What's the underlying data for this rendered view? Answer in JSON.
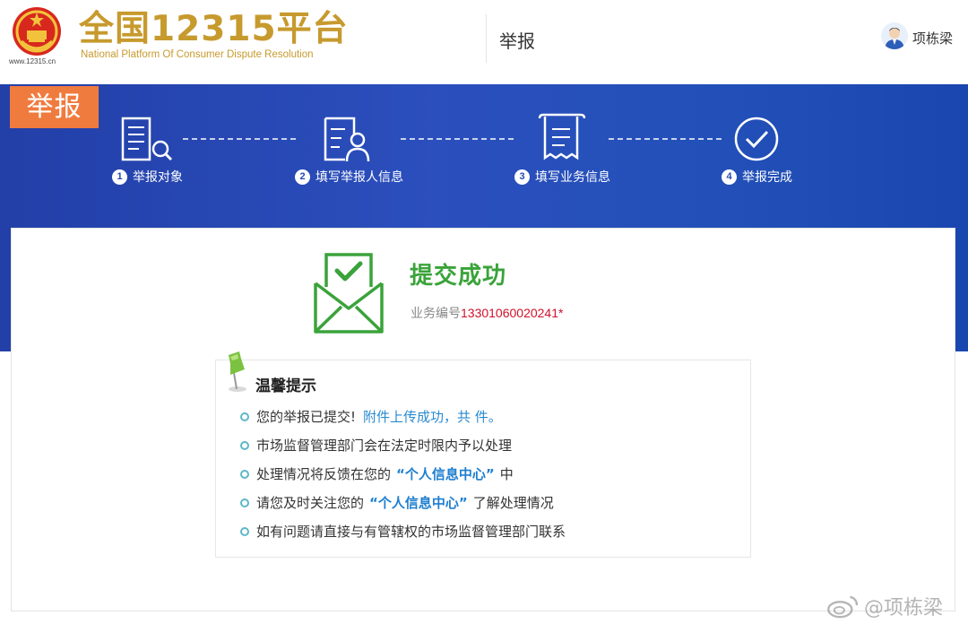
{
  "header": {
    "site_url": "www.12315.cn",
    "brand_title": "全国12315平台",
    "brand_subtitle": "National Platform Of Consumer Dispute Resolution",
    "section": "举报",
    "user_name": "项栋梁"
  },
  "banner": {
    "tag": "举报",
    "steps": [
      {
        "num": "1",
        "label": "举报对象",
        "icon": "building-search-icon"
      },
      {
        "num": "2",
        "label": "填写举报人信息",
        "icon": "person-form-icon"
      },
      {
        "num": "3",
        "label": "填写业务信息",
        "icon": "receipt-icon"
      },
      {
        "num": "4",
        "label": "举报完成",
        "icon": "check-circle-icon"
      }
    ]
  },
  "result": {
    "title": "提交成功",
    "ticket_label": "业务编号",
    "ticket_number": "13301060020241",
    "ticket_suffix": "*"
  },
  "tips": {
    "title": "温馨提示",
    "items": [
      {
        "text": "您的举报已提交!",
        "extra": "附件上传成功，共 件。"
      },
      {
        "text": "市场监督管理部门会在法定时限内予以处理"
      },
      {
        "before": "处理情况将反馈在您的",
        "highlight": "“个人信息中心”",
        "after": "中"
      },
      {
        "before": "请您及时关注您的",
        "highlight": "“个人信息中心”",
        "after": "了解处理情况"
      },
      {
        "text": "如有问题请直接与有管辖权的市场监督管理部门联系"
      }
    ]
  },
  "watermark": "@项栋梁",
  "colors": {
    "brand_gold": "#c79a2e",
    "banner_blue": "#2647b3",
    "tag_orange": "#f07b3f",
    "success_green": "#3aa33a",
    "ticket_red": "#d0102a",
    "link_blue": "#1f7fd0"
  }
}
